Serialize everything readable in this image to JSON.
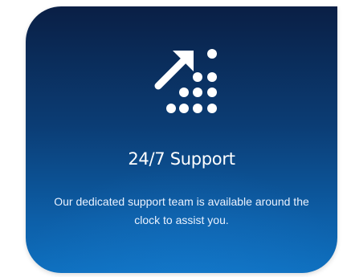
{
  "card": {
    "icon": "growth-arrow-dots-icon",
    "title": "24/7 Support",
    "description": "Our dedicated support team is available around the clock to assist you.",
    "colors": {
      "gradient_top": "#0a1f45",
      "gradient_bottom": "#0e6fbe",
      "text": "#ffffff"
    }
  }
}
